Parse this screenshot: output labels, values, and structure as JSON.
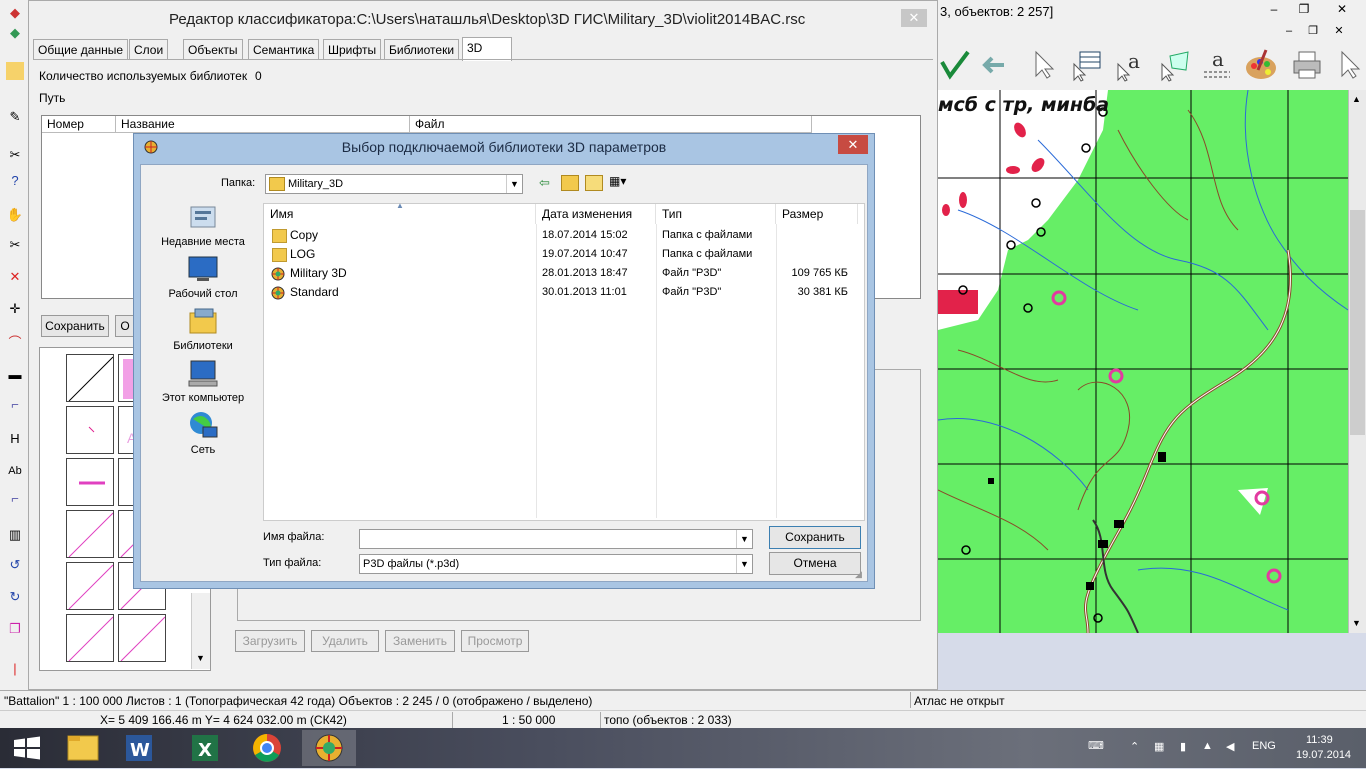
{
  "main_window": {
    "title_fragment": "3, объектов: 2 257]",
    "map_label": "мсб с тр, минба"
  },
  "editor": {
    "title": "Редактор классификатора:C:\\Users\\наташлья\\Desktop\\3D ГИС\\Military_3D\\violit2014BAC.rsc",
    "tabs": [
      "Общие данные",
      "Слои",
      "Объекты",
      "Семантика",
      "Шрифты",
      "Библиотеки",
      "3D"
    ],
    "libs_count_label": "Количество используемых библиотек",
    "libs_count_value": "0",
    "path_label": "Путь",
    "columns": [
      "Номер",
      "Название",
      "Файл"
    ],
    "save_button": "Сохранить",
    "other_button": "О",
    "bottom_buttons": [
      "Загрузить",
      "Удалить",
      "Заменить",
      "Просмотр"
    ]
  },
  "dialog": {
    "title": "Выбор подключаемой библиотеки 3D параметров",
    "folder_label": "Папка:",
    "folder_value": "Military_3D",
    "places": [
      "Недавние места",
      "Рабочий стол",
      "Библиотеки",
      "Этот компьютер",
      "Сеть"
    ],
    "columns": [
      "Имя",
      "Дата изменения",
      "Тип",
      "Размер"
    ],
    "files": [
      {
        "name": "Copy",
        "date": "18.07.2014 15:02",
        "type": "Папка с файлами",
        "size": "",
        "kind": "folder"
      },
      {
        "name": "LOG",
        "date": "19.07.2014 10:47",
        "type": "Папка с файлами",
        "size": "",
        "kind": "folder"
      },
      {
        "name": "Military 3D",
        "date": "28.01.2013 18:47",
        "type": "Файл \"P3D\"",
        "size": "109 765 КБ",
        "kind": "p3d"
      },
      {
        "name": "Standard",
        "date": "30.01.2013 11:01",
        "type": "Файл \"P3D\"",
        "size": "30 381 КБ",
        "kind": "p3d"
      }
    ],
    "filename_label": "Имя файла:",
    "filename_value": "",
    "filetype_label": "Тип файла:",
    "filetype_value": "P3D файлы (*.p3d)",
    "save_button": "Сохранить",
    "cancel_button": "Отмена"
  },
  "status": {
    "map_info": "\"Battalion\"  1 : 100 000   Листов : 1   (Топографическая 42 года)  Объектов : 2 245 / 0  (отображено / выделено)",
    "atlas": "Атлас не открыт",
    "coords": "X= 5 409 166.46 m     Y= 4 624 032.00 m   (СК42)",
    "scale": "1 : 50 000",
    "topo": "топо   (объектов : 2 033)"
  },
  "taskbar": {
    "lang": "ENG",
    "time": "11:39",
    "date": "19.07.2014"
  },
  "colors": {
    "map_green": "#66ee66",
    "dialog_frame": "#a9c5e3",
    "close_red": "#c74b42"
  }
}
